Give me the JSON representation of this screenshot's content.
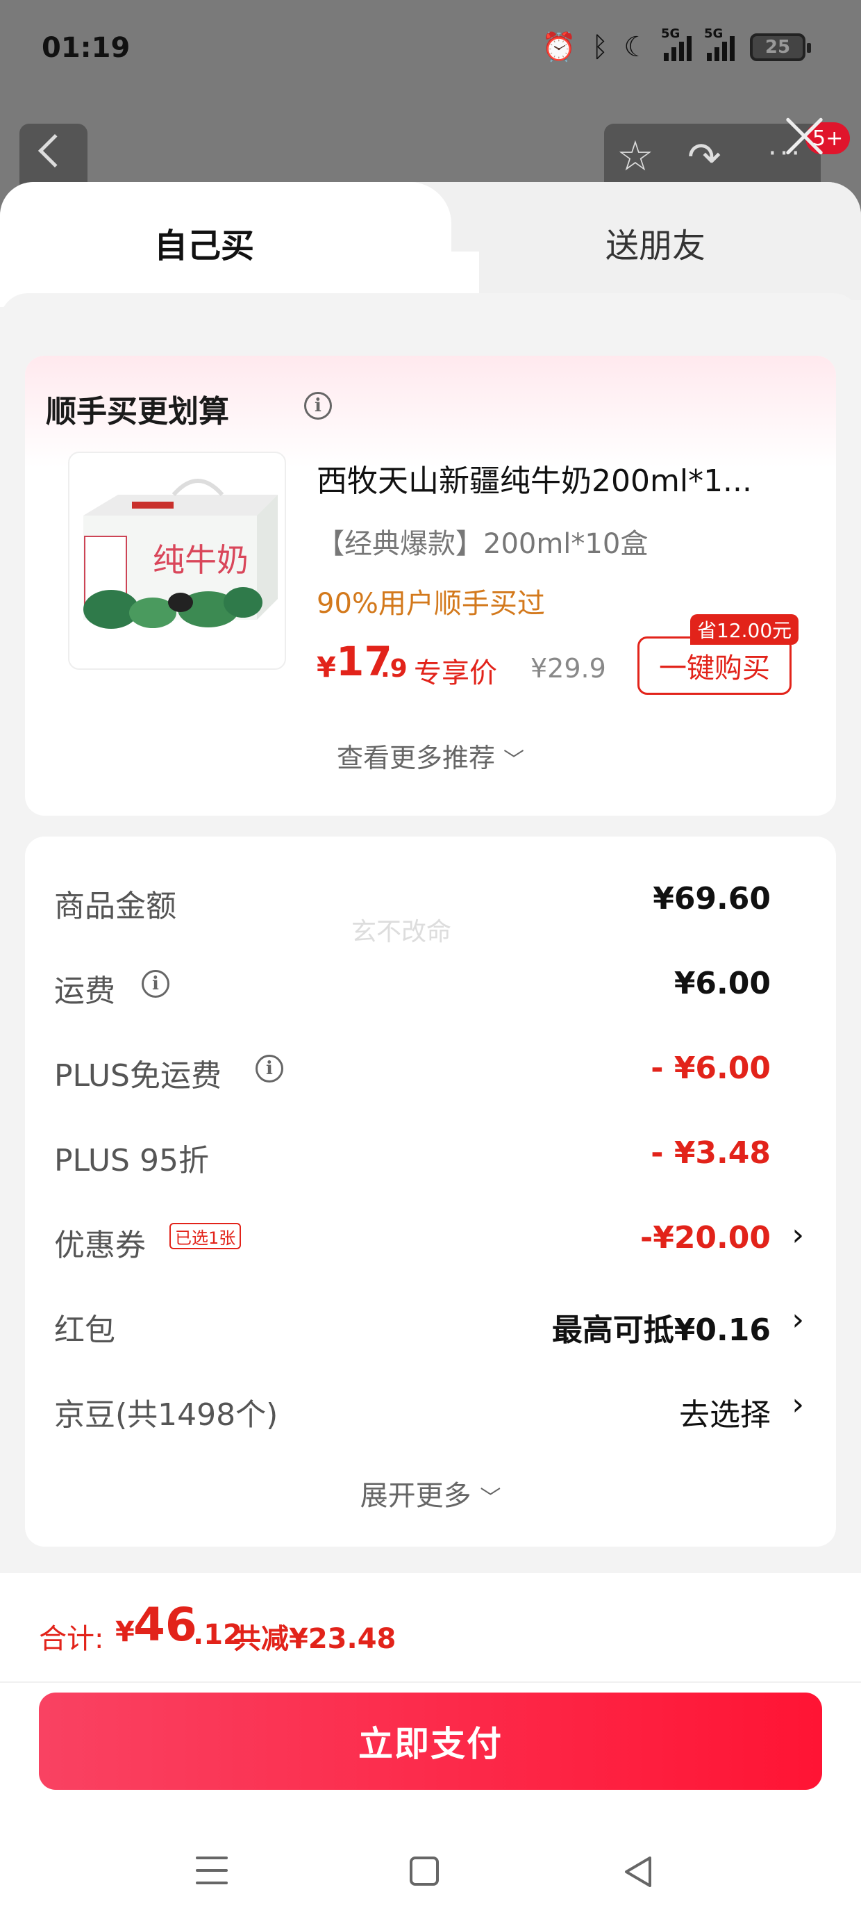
{
  "status_bar": {
    "time": "01:19",
    "signal1_label": "5G",
    "signal2_label": "5G",
    "battery": "25",
    "icons": [
      "alarm-icon",
      "bluetooth-icon",
      "moon-icon",
      "signal-icon",
      "signal-icon",
      "battery-icon"
    ]
  },
  "background": {
    "badge": "5+",
    "icons": [
      "back-icon",
      "star-icon",
      "share-icon",
      "more-icon",
      "close-icon"
    ]
  },
  "tabs": [
    {
      "label": "自己买",
      "active": true
    },
    {
      "label": "送朋友",
      "active": false
    }
  ],
  "recommend": {
    "title": "顺手买更划算",
    "product": {
      "name": "西牧天山新疆纯牛奶200ml*1...",
      "spec": "【经典爆款】200ml*10盒",
      "bought_text": "90%用户顺手买过",
      "price_currency": "¥",
      "price_int": "17",
      "price_dec": ".9",
      "price_tag": "专享价",
      "original_price": "¥29.9",
      "buy_label": "一键购买",
      "save_badge": "省12.00元",
      "image_text": "纯牛奶"
    },
    "more_label": "查看更多推荐"
  },
  "watermark": "玄不改命",
  "breakdown": {
    "rows": [
      {
        "label": "商品金额",
        "value": "¥69.60"
      },
      {
        "label": "运费",
        "value": "¥6.00"
      },
      {
        "label": "PLUS免运费",
        "value": "- ¥6.00"
      },
      {
        "label": "PLUS 95折",
        "value": "- ¥3.48"
      },
      {
        "label": "优惠券",
        "value": "-¥20.00",
        "tag": "已选1张"
      },
      {
        "label": "红包",
        "value": "最高可抵¥0.16"
      },
      {
        "label": "京豆(共1498个)",
        "value": "去选择"
      }
    ],
    "expand_label": "展开更多"
  },
  "footer": {
    "total_label": "合计:",
    "total_currency": "¥",
    "total_int": "46",
    "total_dec": ".12",
    "saved_text": "共减¥23.48",
    "pay_label": "立即支付"
  },
  "colors": {
    "accent_red": "#e2231a",
    "orange": "#d3791c",
    "pay_gradient_start": "#f94262",
    "pay_gradient_end": "#ff1434"
  }
}
